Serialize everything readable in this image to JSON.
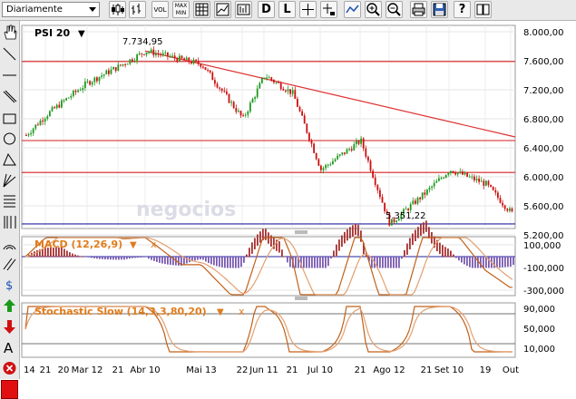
{
  "toolbar": {
    "period_value": "Diariamente",
    "vol_label": "VOL",
    "maxmin_label_top": "MAX",
    "maxmin_label_bottom": "MIN",
    "d_label": "D",
    "l_label": "L",
    "help_label": "?"
  },
  "chart": {
    "instrument": "PSI 20",
    "high_label": "7.734,95",
    "low_label": "5.351,22",
    "watermark": "negocios",
    "price_axis": [
      "8.000,00",
      "7.600,00",
      "7.200,00",
      "6.800,00",
      "6.400,00",
      "6.000,00",
      "5.600,00",
      "5.200,00"
    ],
    "macd_title": "MACD (12,26,9)",
    "macd_axis": [
      "100,000",
      "-100,000",
      "-300,000"
    ],
    "stoch_title": "Stochastic Slow (14,3,3,80,20)",
    "stoch_axis": [
      "90,000",
      "50,000",
      "10,000"
    ],
    "x_axis": [
      "14",
      "21",
      "20",
      "Mar 12",
      "21",
      "Abr 10",
      "Mai 13",
      "22",
      "Jun 11",
      "21",
      "Jul 10",
      "21",
      "Ago 12",
      "21",
      "Set 10",
      "19",
      "Out"
    ],
    "close_marker": "x",
    "dropdown_marker": "▼"
  },
  "colors": {
    "up": "#1f9a1f",
    "down": "#cc1010",
    "support_resistance": "#d62020",
    "trend": "#e03030",
    "low_line": "#2020a0",
    "indicator": "#e07b1a"
  },
  "chart_data": {
    "type": "line",
    "price_series": [
      [
        "14",
        6550
      ],
      [
        "21",
        6850
      ],
      [
        "20",
        7050
      ],
      [
        "Mar 12",
        7300
      ],
      [
        "21",
        7520
      ],
      [
        "Abr 10",
        7734.95
      ],
      [
        "Mai 13",
        7550
      ],
      [
        "22",
        6800
      ],
      [
        "Jun 11",
        7400
      ],
      [
        "21",
        7150
      ],
      [
        "Jul 10",
        6100
      ],
      [
        "21",
        6500
      ],
      [
        "Ago 12",
        5351.22
      ],
      [
        "21",
        5800
      ],
      [
        "Set 10",
        6100
      ],
      [
        "19",
        5900
      ],
      [
        "Out",
        5500
      ]
    ],
    "horizontal_levels": [
      7590,
      6500,
      6060,
      5351.22
    ],
    "trendline": [
      [
        "Abr 10",
        7734.95
      ],
      [
        "Out",
        6550
      ]
    ],
    "ylim": [
      5200,
      8000
    ]
  }
}
